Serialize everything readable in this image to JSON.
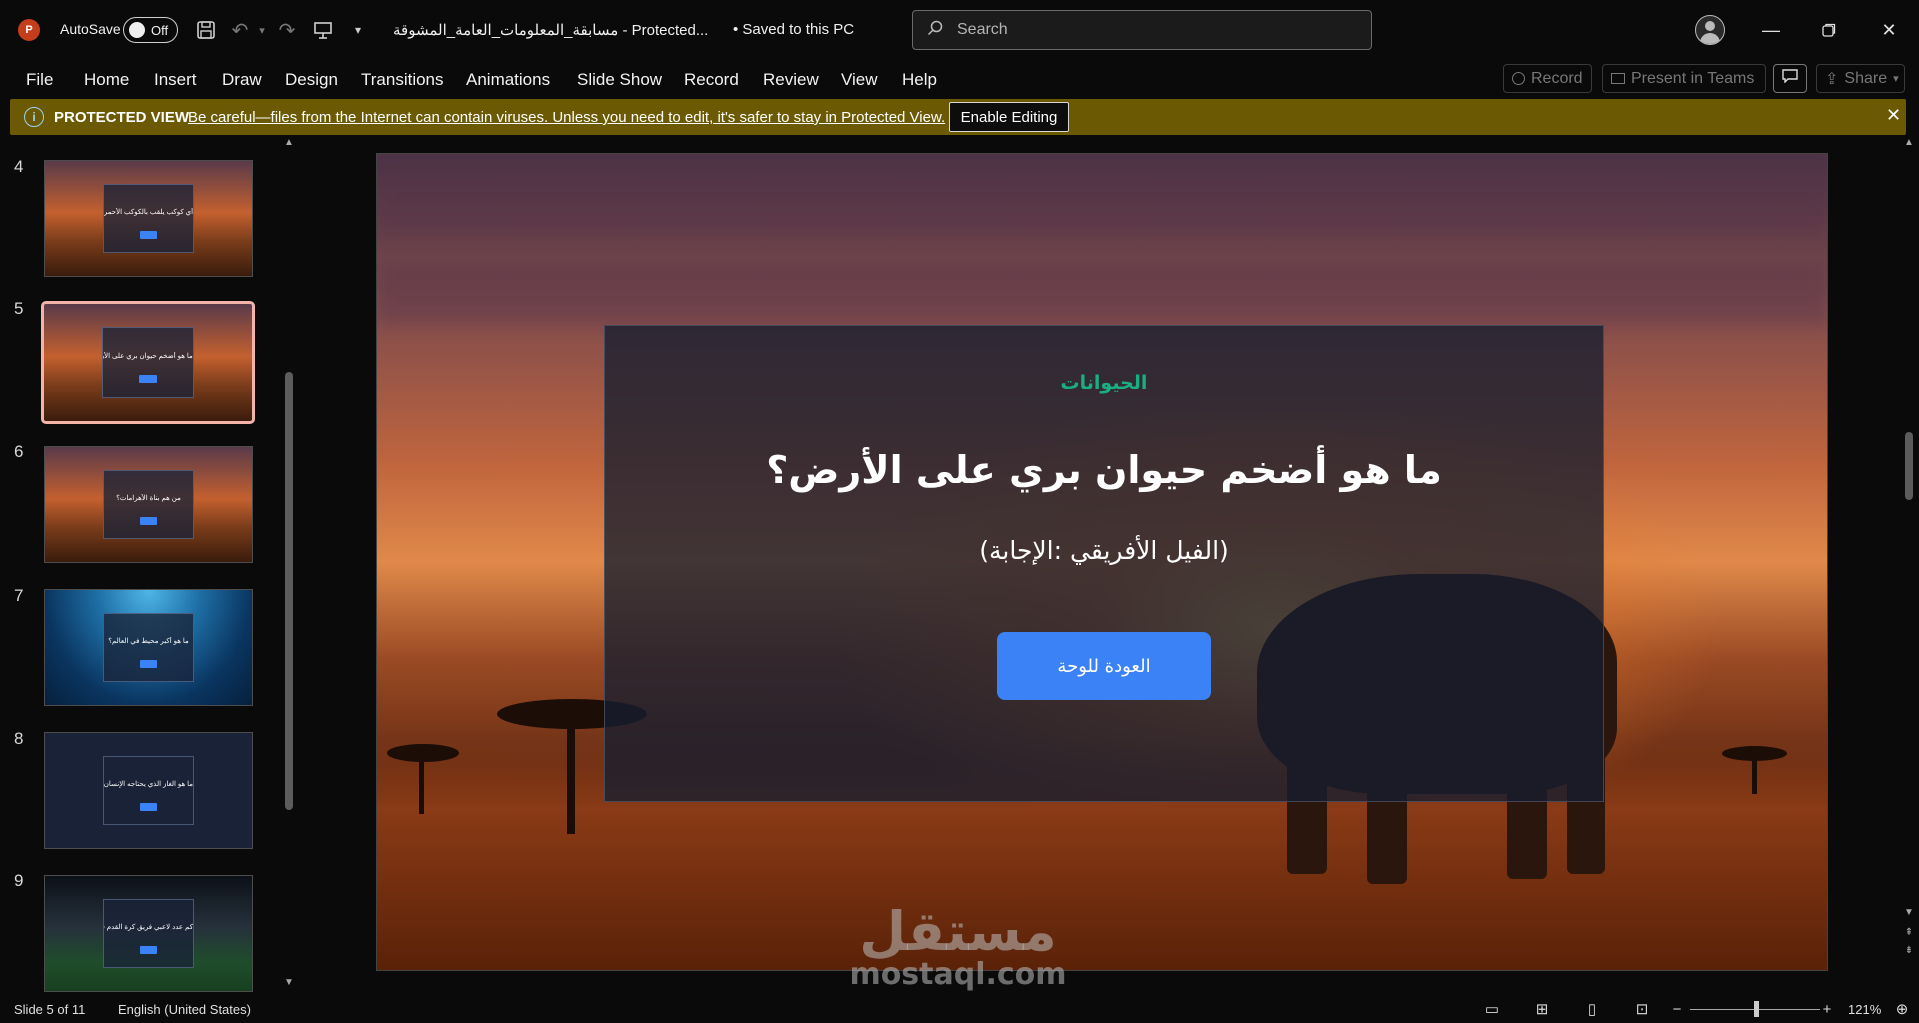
{
  "titlebar": {
    "autosave_label": "AutoSave",
    "autosave_state": "Off",
    "doc_title": "مسابقة_المعلومات_العامة_المشوقة  -  Protected...",
    "saved_status": "•  Saved to this PC",
    "search_placeholder": "Search",
    "icons": [
      "powerpoint-logo",
      "save-icon",
      "undo-icon",
      "redo-icon",
      "present-icon",
      "customize-qat-icon",
      "search-icon",
      "account-icon",
      "minimize-icon",
      "restore-icon",
      "close-icon"
    ]
  },
  "menu": {
    "items": [
      "File",
      "Home",
      "Insert",
      "Draw",
      "Design",
      "Transitions",
      "Animations",
      "Slide Show",
      "Record",
      "Review",
      "View",
      "Help"
    ],
    "record_label": "Record",
    "present_teams_label": "Present in Teams",
    "share_label": "Share"
  },
  "protected_view": {
    "title": "PROTECTED VIEW",
    "message": "Be careful—files from the Internet can contain viruses. Unless you need to edit, it's safer to stay in Protected View.",
    "enable_button": "Enable Editing"
  },
  "thumbnails": [
    {
      "number": "4",
      "title": "أي كوكب يلقب بالكوكب الأحمر؟",
      "background": "sunset",
      "selected": false
    },
    {
      "number": "5",
      "title": "ما هو أضخم حيوان بري على الأرض؟",
      "background": "sunset",
      "selected": true
    },
    {
      "number": "6",
      "title": "من هم بناة الأهرامات؟",
      "background": "sunset",
      "selected": false
    },
    {
      "number": "7",
      "title": "ما هو أكبر محيط في العالم؟",
      "background": "ocean",
      "selected": false
    },
    {
      "number": "8",
      "title": "ما هو الغاز الذي يحتاجه الإنسان للتنفس؟",
      "background": "navy",
      "selected": false
    },
    {
      "number": "9",
      "title": "كم عدد لاعبي فريق كرة القدم في الملعب؟",
      "background": "stadium",
      "selected": false
    }
  ],
  "slide": {
    "category": "الحيوانات",
    "question": "ما هو أضخم حيوان بري على الأرض؟",
    "answer": "(الفيل الأفريقي :الإجابة)",
    "back_button": "العودة للوحة"
  },
  "watermark": {
    "arabic": "مستقل",
    "latin": "mostaql.com"
  },
  "status": {
    "slide_indicator": "Slide 5 of 11",
    "language": "English (United States)",
    "zoom": "121%"
  },
  "colors": {
    "protected_bar": "#6b5a03",
    "category_green": "#19b081",
    "button_blue": "#3b82f6",
    "selected_thumb_border": "#f3b3a9",
    "app_accent": "#c43e1c"
  }
}
